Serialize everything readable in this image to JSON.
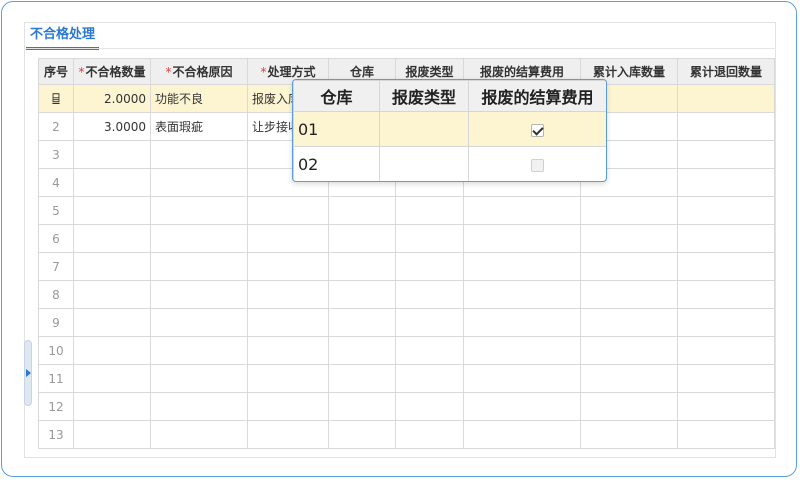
{
  "tab": {
    "label": "不合格处理"
  },
  "grid": {
    "required_mark": "*",
    "columns": [
      "序号",
      "不合格数量",
      "不合格原因",
      "处理方式",
      "仓库",
      "报废类型",
      "报废的结算费用",
      "累计入库数量",
      "累计退回数量"
    ],
    "rows": [
      {
        "seq": "⌸",
        "qty": "2.0000",
        "reason": "功能不良",
        "method": "报废入库",
        "selected": true
      },
      {
        "seq": "2",
        "qty": "3.0000",
        "reason": "表面瑕疵",
        "method": "让步接收"
      },
      {
        "seq": "3"
      },
      {
        "seq": "4"
      },
      {
        "seq": "5"
      },
      {
        "seq": "6"
      },
      {
        "seq": "7"
      },
      {
        "seq": "8"
      },
      {
        "seq": "9"
      },
      {
        "seq": "10"
      },
      {
        "seq": "11"
      },
      {
        "seq": "12"
      },
      {
        "seq": "13"
      }
    ]
  },
  "popup": {
    "columns": [
      "仓库",
      "报废类型",
      "报废的结算费用"
    ],
    "rows": [
      {
        "warehouse": "01",
        "type": "",
        "settle": true
      },
      {
        "warehouse": "02",
        "type": "",
        "settle": false
      }
    ]
  }
}
